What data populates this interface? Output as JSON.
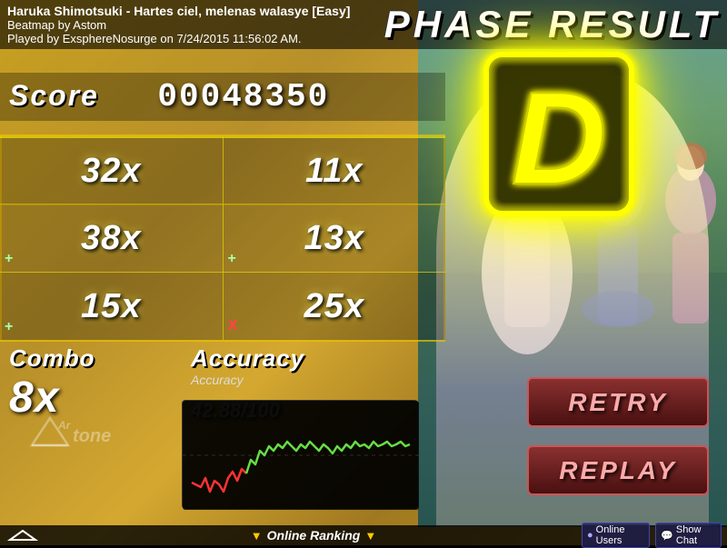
{
  "song": {
    "title": "Haruka Shimotsuki - Hartes ciel, melenas walasye [Easy]",
    "beatmap_by": "Beatmap by Astom",
    "played_by": "Played by ExsphereNosurge on 7/24/2015 11:56:02 AM."
  },
  "header": {
    "phase_result": "PHASE RESULT"
  },
  "score": {
    "label": "Score",
    "value": "00048350"
  },
  "stats": {
    "row1": {
      "left_value": "32x",
      "right_value": "11x"
    },
    "row2": {
      "left_icon": "+",
      "left_value": "38x",
      "right_icon": "+",
      "right_value": "13x"
    },
    "row3": {
      "left_icon": "+",
      "left_value": "15x",
      "right_icon": "x",
      "right_value": "25x"
    }
  },
  "combo": {
    "label": "Combo",
    "value": "8x"
  },
  "accuracy": {
    "label": "Accuracy",
    "chart_label": "Accuracy",
    "value": "42.88",
    "suffix": "/100"
  },
  "grade": "D",
  "buttons": {
    "retry": "RETRY",
    "replay": "REPLAY"
  },
  "footer": {
    "online_ranking_left": "▼",
    "online_ranking_text": "Online Ranking",
    "online_ranking_right": "▼",
    "online_users": "Online Users",
    "show_chat": "Show Chat"
  },
  "logo": "Ar tone"
}
